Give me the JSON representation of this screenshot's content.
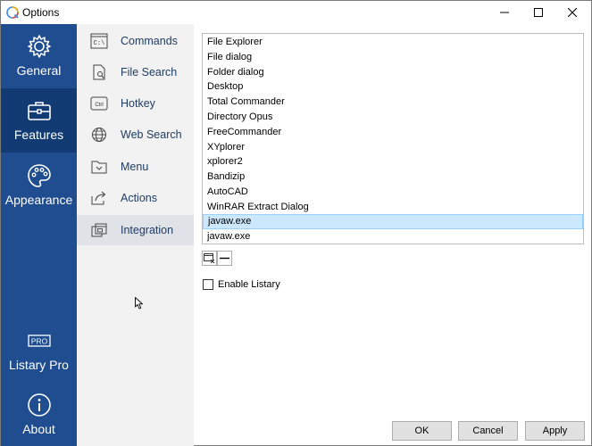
{
  "window": {
    "title": "Options",
    "controls": {
      "minimize": "minimize-icon",
      "maximize": "maximize-icon",
      "close": "close-icon"
    }
  },
  "rail": {
    "items": [
      {
        "label": "General",
        "icon": "gear-icon",
        "active": false
      },
      {
        "label": "Features",
        "icon": "briefcase-icon",
        "active": true
      },
      {
        "label": "Appearance",
        "icon": "palette-icon",
        "active": false
      },
      {
        "label": "Listary Pro",
        "icon": "pro-badge-icon",
        "icon_text": "PRO",
        "active": false
      },
      {
        "label": "About",
        "icon": "info-icon",
        "active": false
      }
    ]
  },
  "subnav": {
    "items": [
      {
        "label": "Commands",
        "icon": "command-prompt-icon",
        "icon_text": "C:\\",
        "active": false
      },
      {
        "label": "File Search",
        "icon": "file-search-icon",
        "active": false
      },
      {
        "label": "Hotkey",
        "icon": "keyboard-key-icon",
        "icon_text": "Ctrl",
        "active": false
      },
      {
        "label": "Web Search",
        "icon": "globe-icon",
        "active": false
      },
      {
        "label": "Menu",
        "icon": "menu-folder-icon",
        "active": false
      },
      {
        "label": "Actions",
        "icon": "share-arrow-icon",
        "active": false
      },
      {
        "label": "Integration",
        "icon": "window-integration-icon",
        "active": true
      }
    ]
  },
  "integration": {
    "list": [
      "File Explorer",
      "File dialog",
      "Folder dialog",
      "Desktop",
      "Total Commander",
      "Directory Opus",
      "FreeCommander",
      "XYplorer",
      "xplorer2",
      "Bandizip",
      "AutoCAD",
      "WinRAR Extract Dialog",
      "javaw.exe",
      "javaw.exe"
    ],
    "selected_index": 12,
    "enable_label": "Enable Listary",
    "enable_checked": false
  },
  "buttons": {
    "ok": "OK",
    "cancel": "Cancel",
    "apply": "Apply"
  },
  "colors": {
    "rail_bg": "#1f4d8f",
    "rail_active": "#123a73",
    "subnav_bg": "#f2f2f2",
    "subnav_active": "#dfe3e8",
    "selection": "#cce8ff"
  }
}
